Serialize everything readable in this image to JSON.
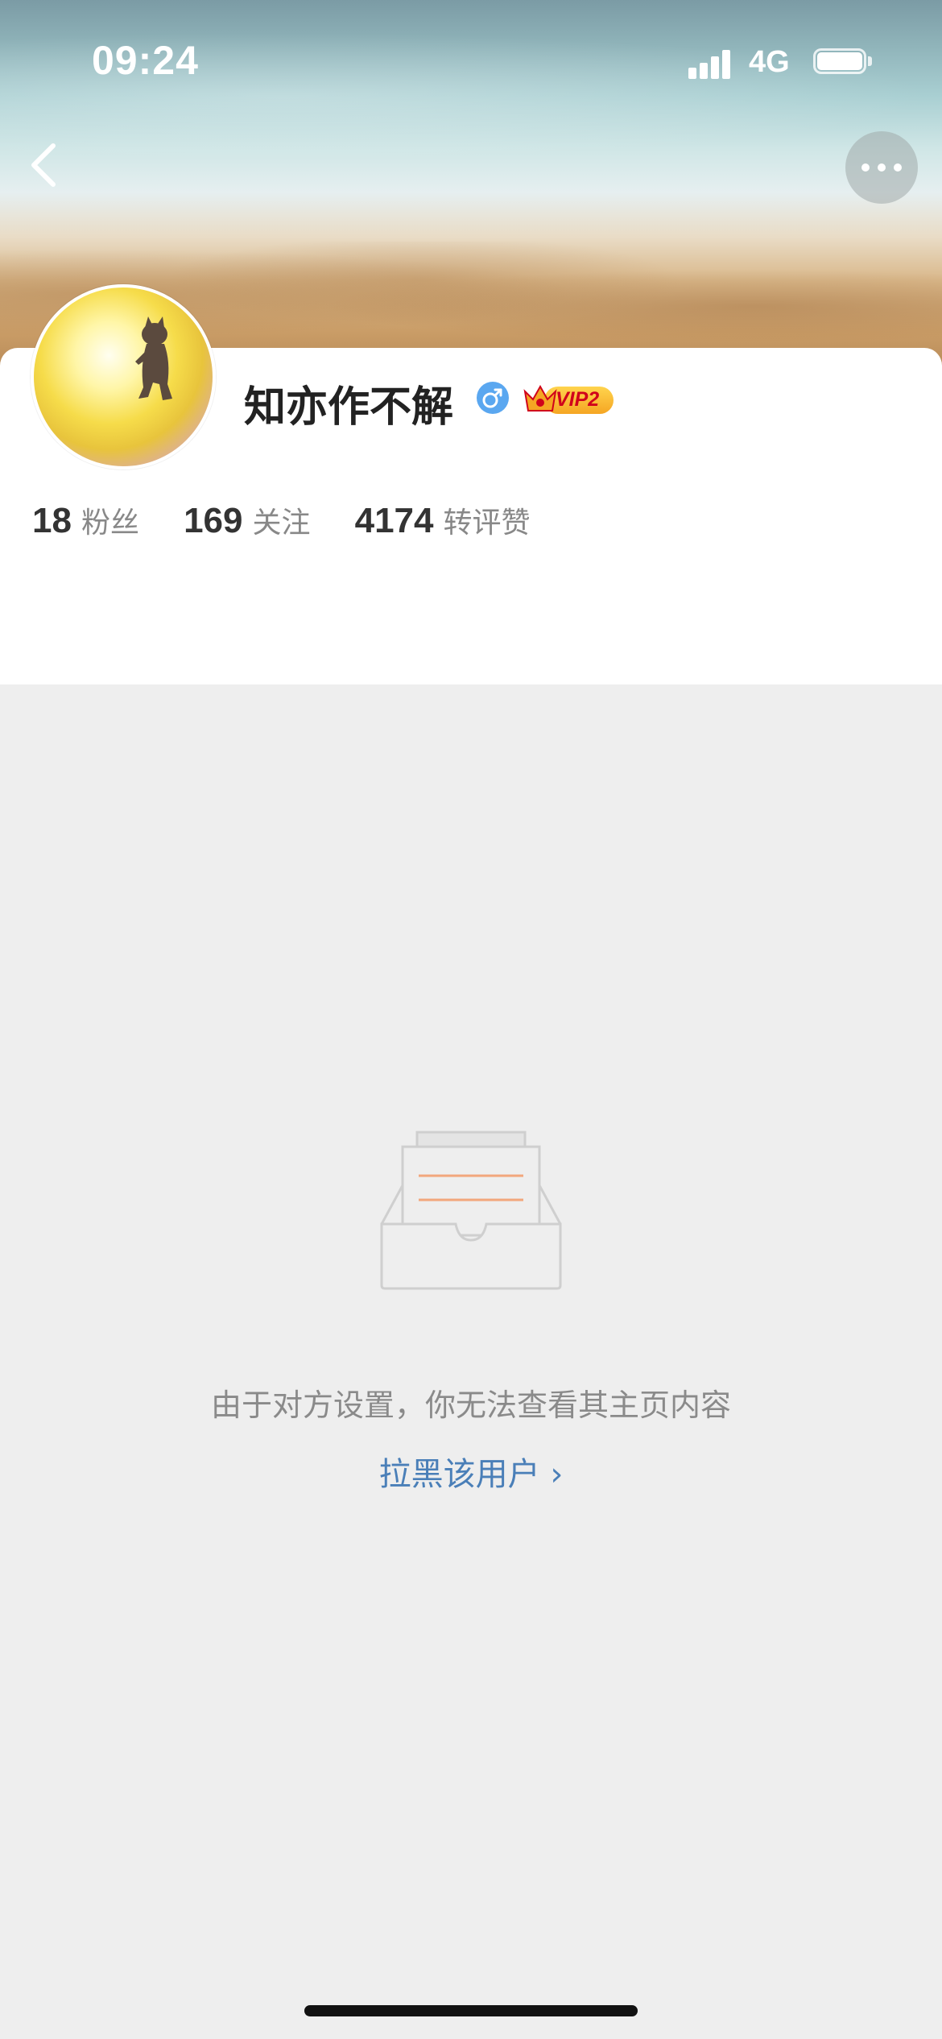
{
  "status_bar": {
    "time": "09:24",
    "network": "4G"
  },
  "nav": {
    "back_icon": "chevron-left-icon",
    "more_icon": "more-horizontal-icon"
  },
  "profile": {
    "username": "知亦作不解",
    "gender_icon": "male-icon",
    "vip_label": "VIP2",
    "stats": [
      {
        "count": "18",
        "label": "粉丝"
      },
      {
        "count": "169",
        "label": "关注"
      },
      {
        "count": "4174",
        "label": "转评赞"
      }
    ]
  },
  "empty_state": {
    "icon": "empty-inbox-icon",
    "message": "由于对方设置，你无法查看其主页内容",
    "block_link": "拉黑该用户 ›"
  },
  "colors": {
    "link": "#4a7fb8",
    "page_background": "#eeeeee",
    "gender_badge": "#5aa7f0",
    "vip_text": "#d0021b"
  }
}
